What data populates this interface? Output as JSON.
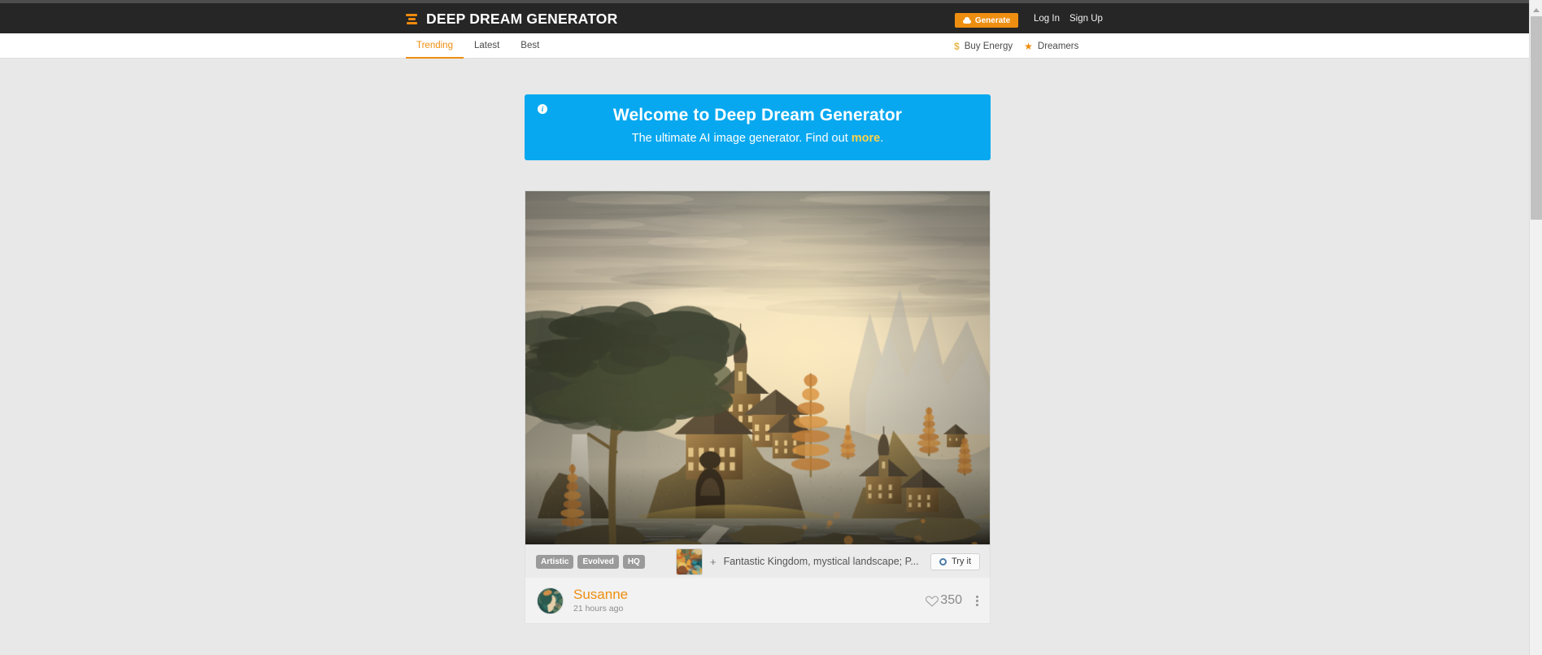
{
  "header": {
    "logo_icon": "stacked-bars-logo-icon",
    "brand": "DEEP DREAM GENERATOR",
    "generate_button": {
      "label": "Generate",
      "icon": "cloud-icon",
      "color": "#ee8e10"
    },
    "login_label": "Log In",
    "signup_label": "Sign Up",
    "background": "#262626"
  },
  "nav": {
    "tabs": [
      {
        "label": "Trending",
        "active": true
      },
      {
        "label": "Latest",
        "active": false
      },
      {
        "label": "Best",
        "active": false
      }
    ],
    "links": [
      {
        "label": "Buy Energy",
        "icon": "dollar-icon"
      },
      {
        "label": "Dreamers",
        "icon": "star-icon"
      }
    ],
    "active_color": "#ee8e10"
  },
  "welcome_banner": {
    "icon": "info-icon",
    "title": "Welcome to Deep Dream Generator",
    "subtitle_before": "The ultimate AI image generator. Find out ",
    "link_label": "more",
    "subtitle_after": ".",
    "background": "#07a8f0",
    "link_color": "#ffd24a"
  },
  "post": {
    "artwork_alt": "Fantastic kingdom fantasy landscape painting with castles on cliffs, waterfalls, autumn trees and misty mountains",
    "tags": [
      "Artistic",
      "Evolved",
      "HQ"
    ],
    "prompt_prefix": "+",
    "prompt_text": "Fantastic Kingdom, mystical landscape; P...",
    "prompt_thumb": "prompt-thumbnail",
    "try_it": {
      "label": "Try it",
      "icon": "gear-icon"
    },
    "author": {
      "name": "Susanne",
      "time": "21 hours ago",
      "avatar": "user-avatar"
    },
    "likes": {
      "count": "350",
      "icon": "heart-icon"
    },
    "menu_icon": "kebab-menu-icon"
  },
  "scrollbar": {
    "up_arrow": "scroll-up-arrow-icon"
  }
}
